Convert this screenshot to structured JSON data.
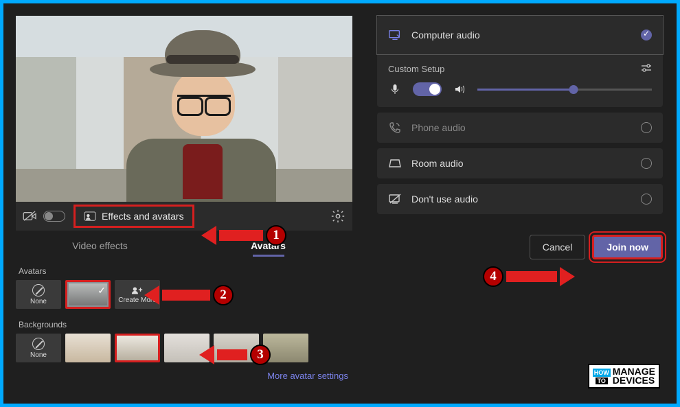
{
  "video": {
    "effects_button": "Effects and avatars"
  },
  "tabs": {
    "video_effects": "Video effects",
    "avatars": "Avatars"
  },
  "avatars_section": {
    "label": "Avatars",
    "none": "None",
    "create_more": "Create More"
  },
  "backgrounds_section": {
    "label": "Backgrounds",
    "none": "None"
  },
  "more_link": "More avatar settings",
  "audio": {
    "computer": "Computer audio",
    "custom_setup": "Custom Setup",
    "phone": "Phone audio",
    "room": "Room audio",
    "dont_use": "Don't use audio"
  },
  "footer": {
    "cancel": "Cancel",
    "join": "Join now"
  },
  "annotations": {
    "n1": "1",
    "n2": "2",
    "n3": "3",
    "n4": "4"
  },
  "watermark": {
    "how": "HOW",
    "to": "TO",
    "line1": "MANAGE",
    "line2": "DEVICES"
  }
}
